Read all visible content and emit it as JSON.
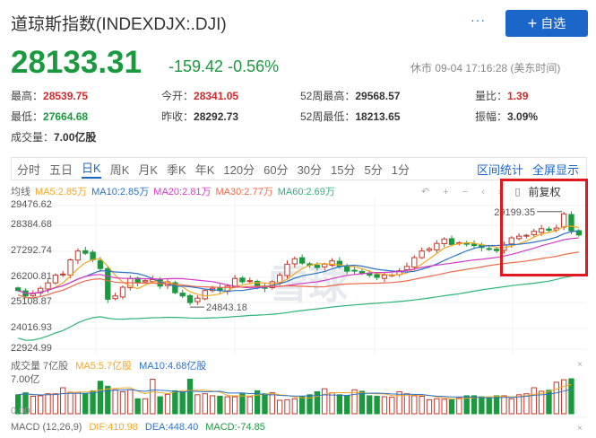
{
  "header": {
    "title": "道琼斯指数(INDEXDJX:.DJI)",
    "more": "···",
    "add_label": "自选",
    "add_icon": "plus-icon"
  },
  "quote": {
    "price": "28133.31",
    "change": "-159.42",
    "change_pct": "-0.56%",
    "status": "休市 09-04 17:16:28 (美东时间)"
  },
  "stats": [
    {
      "label": "最高：",
      "value": "28539.75",
      "tone": "red"
    },
    {
      "label": "今开：",
      "value": "28341.05",
      "tone": "red"
    },
    {
      "label": "52周最高：",
      "value": "29568.57",
      "tone": "dark"
    },
    {
      "label": "量比：",
      "value": "1.39",
      "tone": "red"
    },
    {
      "label": "最低：",
      "value": "27664.68",
      "tone": "green"
    },
    {
      "label": "昨收：",
      "value": "28292.73",
      "tone": "dark"
    },
    {
      "label": "52周最低：",
      "value": "18213.65",
      "tone": "dark"
    },
    {
      "label": "振幅：",
      "value": "3.09%",
      "tone": "dark"
    },
    {
      "label": "成交量：",
      "value": "7.00亿股",
      "tone": "dark"
    }
  ],
  "tabs": [
    "分时",
    "五日",
    "日K",
    "周K",
    "月K",
    "季K",
    "年K",
    "120分",
    "60分",
    "30分",
    "15分",
    "5分",
    "1分"
  ],
  "active_tab": "日K",
  "tab_actions": [
    "区间统计",
    "全屏显示"
  ],
  "ma_legend": {
    "label": "均线",
    "items": [
      {
        "text": "MA5:2.85万",
        "color": "#f5a623"
      },
      {
        "text": "MA10:2.85万",
        "color": "#2a73c9"
      },
      {
        "text": "MA20:2.81万",
        "color": "#d63bc8"
      },
      {
        "text": "MA30:2.77万",
        "color": "#ee6a4a"
      },
      {
        "text": "MA60:2.69万",
        "color": "#2fb47a"
      }
    ]
  },
  "controls": {
    "undo": "↶",
    "zoom_in": "+",
    "zoom_out": "−",
    "prev": "‹",
    "next": "›",
    "candle": "▯",
    "adjust": "前复权"
  },
  "chart_data": {
    "type": "candlestick",
    "y_ticks": [
      "29476.62",
      "28384.68",
      "27292.74",
      "26200.81",
      "25108.87",
      "24016.93",
      "22924.99"
    ],
    "ylim": [
      22924.99,
      29476.62
    ],
    "annotations": {
      "high": "29199.35",
      "low": "24843.18"
    },
    "closes": [
      25600,
      25350,
      25450,
      25700,
      25950,
      26300,
      26350,
      27000,
      27400,
      27300,
      27000,
      26600,
      25200,
      25350,
      25750,
      26150,
      25950,
      26050,
      26100,
      25800,
      26000,
      25500,
      25350,
      25050,
      25250,
      25600,
      25700,
      25600,
      25800,
      26150,
      26000,
      26050,
      25800,
      25700,
      26000,
      26300,
      26800,
      27050,
      26850,
      26750,
      26650,
      26800,
      26950,
      26700,
      26480,
      26500,
      26380,
      26300,
      26200,
      26300,
      26310,
      26500,
      26700,
      27100,
      27400,
      27500,
      27750,
      27950,
      27700,
      27780,
      27720,
      27650,
      27560,
      27500,
      27420,
      27680,
      28000,
      28080,
      28120,
      28300,
      28420,
      28350,
      28450,
      29100,
      28330,
      28133.31
    ],
    "volume": {
      "max_label": "7.00亿",
      "zero_label": "0.00",
      "values": [
        3.8,
        4.2,
        3.5,
        3.6,
        4.0,
        4.0,
        5.2,
        4.3,
        4.3,
        4.0,
        4.6,
        6.5,
        5.5,
        4.8,
        4.4,
        4.8,
        3.0,
        3.0,
        6.9,
        3.4,
        3.9,
        4.6,
        4.4,
        6.9,
        3.8,
        4.0,
        3.6,
        3.5,
        3.4,
        3.4,
        4.0,
        3.4,
        4.6,
        4.0,
        4.2,
        2.7,
        2.8,
        3.0,
        3.4,
        3.8,
        4.4,
        5.0,
        4.2,
        3.8,
        3.6,
        4.8,
        4.5,
        3.6,
        3.5,
        3.4,
        3.3,
        4.4,
        4.0,
        3.6,
        3.5,
        2.8,
        3.0,
        2.9,
        2.8,
        3.2,
        3.6,
        3.6,
        3.4,
        3.2,
        3.6,
        3.6,
        3.0,
        3.8,
        4.0,
        5.2,
        4.5,
        4.7,
        6.3,
        6.8,
        7.0
      ]
    },
    "watermark": "雪球"
  },
  "volume_panel": {
    "title": "成交量 7亿股",
    "ma5": "MA5:5.7亿股",
    "ma10": "MA10:4.68亿股",
    "close": "×"
  },
  "macd_panel": {
    "title": "MACD (12,26,9)",
    "dif": "DIF:410.98",
    "dea": "DEA:448.40",
    "macd": "MACD:-74.85",
    "close": "×"
  }
}
